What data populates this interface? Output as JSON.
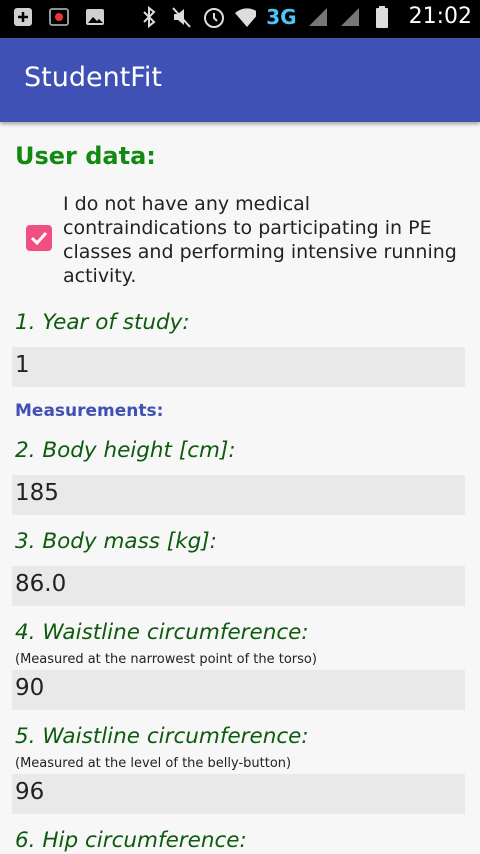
{
  "status_bar": {
    "time": "21:02",
    "network": "3G",
    "icons": [
      "add-box-icon",
      "cast-icon",
      "image-icon",
      "bluetooth-icon",
      "mute-icon",
      "alarm-icon",
      "wifi-icon",
      "signal-icon",
      "signal-icon",
      "battery-icon"
    ]
  },
  "app_bar": {
    "title": "StudentFit"
  },
  "form": {
    "heading": "User data:",
    "consent": {
      "checked": true,
      "text": "I do not have any medical contraindications to participating in PE classes and performing intensive running activity."
    },
    "year_label": "1. Year of study:",
    "year_value": "1",
    "measurements_heading": "Measurements:",
    "height_label": "2. Body height [cm]:",
    "height_value": "185",
    "mass_label": "3. Body mass [kg]:",
    "mass_value": "86.0",
    "waist1_label": "4. Waistline circumference:",
    "waist1_note": "(Measured at the narrowest point of the torso)",
    "waist1_value": "90",
    "waist2_label": "5. Waistline circumference:",
    "waist2_note": "(Measured at the level of the belly-button)",
    "waist2_value": "96",
    "hip_label": "6. Hip circumference:"
  },
  "colors": {
    "app_bar": "#3f51b5",
    "heading_green": "#128a12",
    "label_green": "#0e5a0e",
    "section_blue": "#3f51b5",
    "checkbox": "#f04f82"
  }
}
